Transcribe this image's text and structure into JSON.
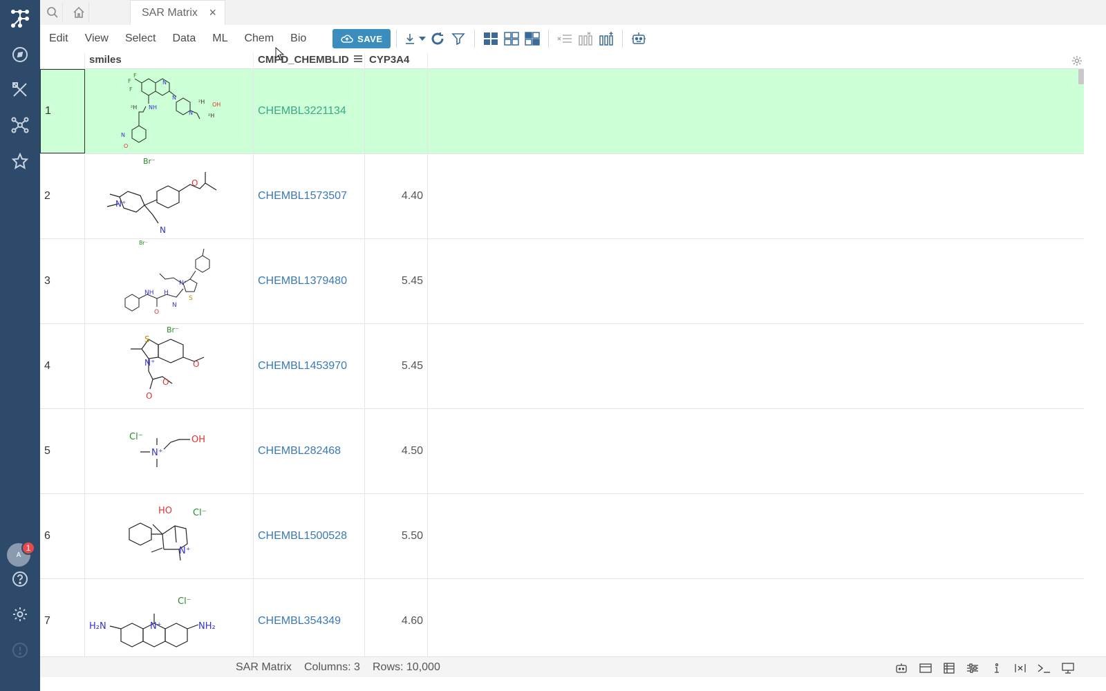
{
  "tab": {
    "title": "SAR Matrix",
    "close": "×"
  },
  "menu": [
    "Edit",
    "View",
    "Select",
    "Data",
    "ML",
    "Chem",
    "Bio"
  ],
  "toolbar": {
    "save_label": "SAVE"
  },
  "columns": [
    "smiles",
    "CMPD_CHEMBLID",
    "CYP3A4"
  ],
  "rows": [
    {
      "n": "1",
      "id": "CHEMBL3221134",
      "cyp": ""
    },
    {
      "n": "2",
      "id": "CHEMBL1573507",
      "cyp": "4.40"
    },
    {
      "n": "3",
      "id": "CHEMBL1379480",
      "cyp": "5.45"
    },
    {
      "n": "4",
      "id": "CHEMBL1453970",
      "cyp": "5.45"
    },
    {
      "n": "5",
      "id": "CHEMBL282468",
      "cyp": "4.50"
    },
    {
      "n": "6",
      "id": "CHEMBL1500528",
      "cyp": "5.50"
    },
    {
      "n": "7",
      "id": "CHEMBL354349",
      "cyp": "4.60"
    }
  ],
  "mol_labels": {
    "r1": [
      "F",
      "F",
      "F",
      "N",
      "NH",
      "²H",
      "N",
      "N",
      "²H",
      "OH",
      "²H",
      "N",
      "O"
    ],
    "r2": [
      "Br⁻",
      "N⁺",
      "O",
      "N"
    ],
    "r3": [
      "Br⁻",
      "N⁺",
      "S",
      "NH",
      "H",
      "N",
      "O"
    ],
    "r4": [
      "Br⁻",
      "S",
      "N⁺",
      "O",
      "O",
      "O"
    ],
    "r5": [
      "Cl⁻",
      "N⁺",
      "OH"
    ],
    "r6": [
      "HO",
      "Cl⁻",
      "N⁺"
    ],
    "r7": [
      "Cl⁻",
      "H₂N",
      "N⁺",
      "NH₂"
    ]
  },
  "avatar": {
    "initial": "A",
    "badge": "1"
  },
  "status": {
    "name": "SAR Matrix",
    "columns": "Columns: 3",
    "rows": "Rows: 10,000"
  }
}
